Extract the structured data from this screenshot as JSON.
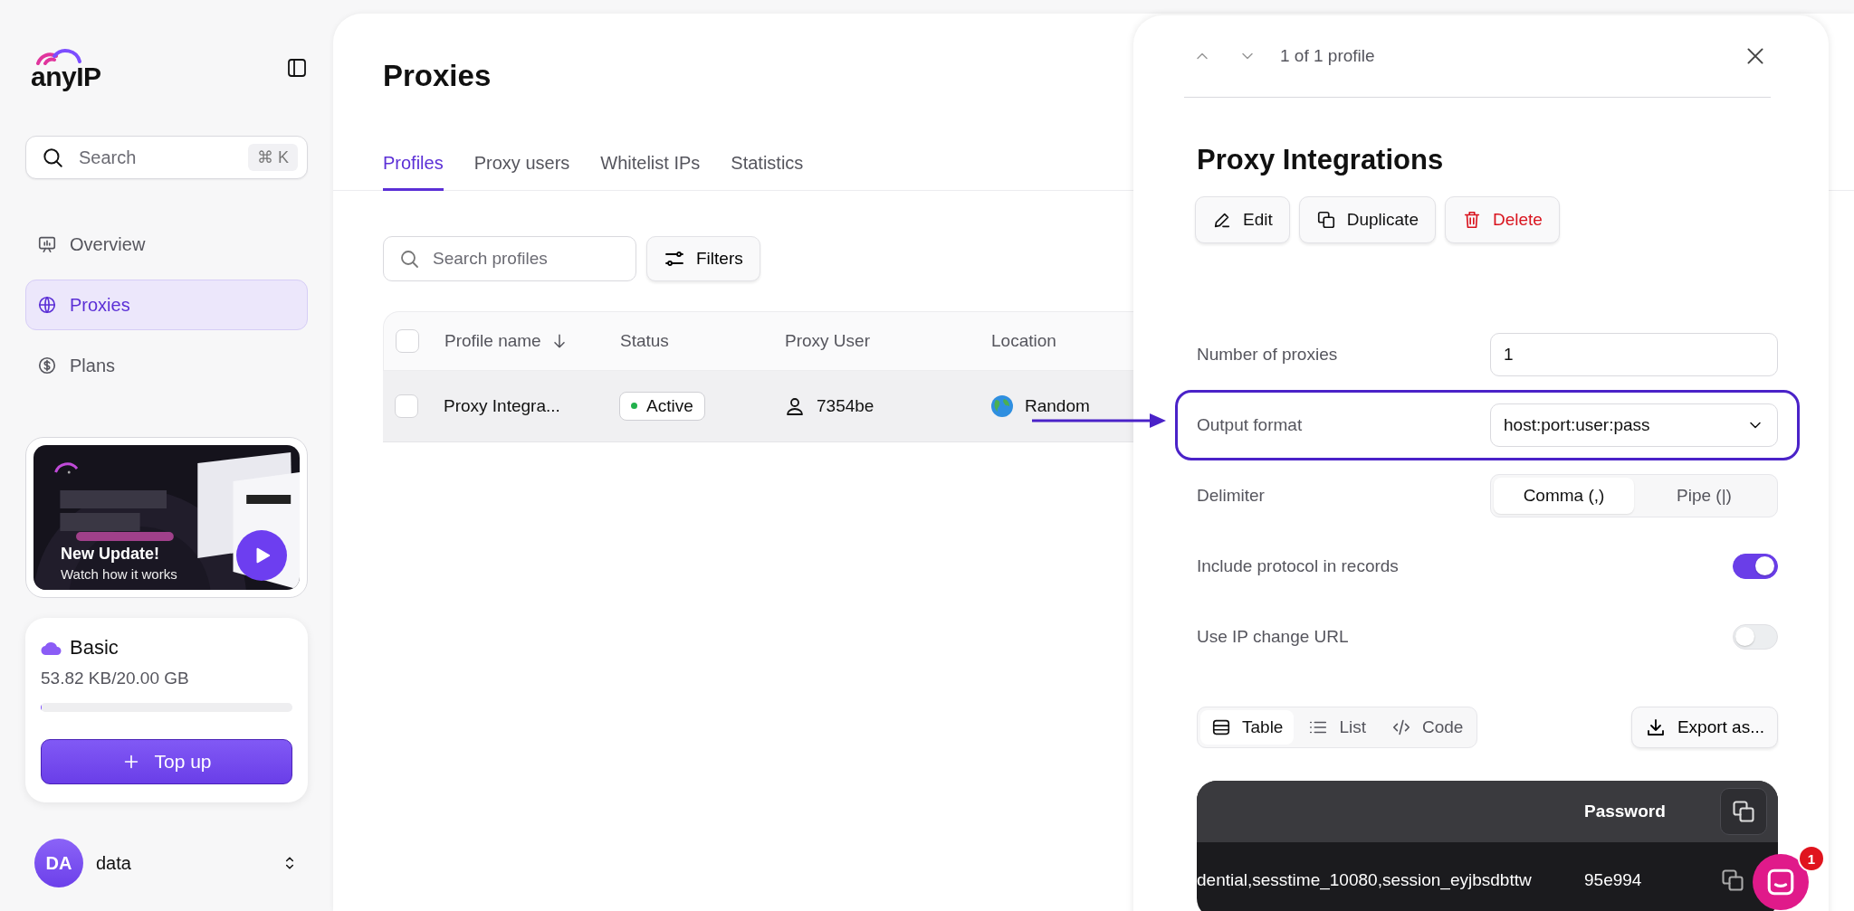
{
  "sidebar": {
    "logo": "anyIP",
    "search": {
      "placeholder": "Search",
      "shortcut": "⌘ K"
    },
    "nav": [
      {
        "label": "Overview",
        "selected": false
      },
      {
        "label": "Proxies",
        "selected": true
      },
      {
        "label": "Plans",
        "selected": false
      }
    ],
    "promo": {
      "title": "New Update!",
      "subtitle": "Watch how it works"
    },
    "plan": {
      "name": "Basic",
      "usage": "53.82 KB/20.00 GB",
      "level": 0.003,
      "button": "Top up"
    },
    "user": {
      "initials": "DA",
      "name": "data"
    }
  },
  "main": {
    "title": "Proxies",
    "tabs": [
      {
        "label": "Profiles",
        "selected": true
      },
      {
        "label": "Proxy users",
        "selected": false
      },
      {
        "label": "Whitelist IPs",
        "selected": false
      },
      {
        "label": "Statistics",
        "selected": false
      }
    ],
    "search": {
      "placeholder": "Search profiles"
    },
    "filters": "Filters",
    "table": {
      "all_checked": false,
      "columns": [
        "Profile name",
        "Status",
        "Proxy User",
        "Location"
      ],
      "rows": [
        {
          "checked": false,
          "selected": true,
          "name": "Proxy Integra...",
          "status": "Active",
          "user": "7354be",
          "location": "Random"
        }
      ]
    }
  },
  "panel": {
    "counter": "1 of 1 profile",
    "title": "Proxy Integrations",
    "actions": [
      {
        "label": "Edit",
        "kind": "edit"
      },
      {
        "label": "Duplicate",
        "kind": "duplicate"
      },
      {
        "label": "Delete",
        "kind": "delete"
      }
    ],
    "fields": [
      {
        "kind": "input",
        "label": "Number of proxies",
        "value": "1"
      },
      {
        "kind": "select",
        "label": "Output format",
        "value": "host:port:user:pass",
        "highlighted": true
      },
      {
        "kind": "segmented",
        "label": "Delimiter",
        "options": [
          {
            "label": "Comma (,)",
            "selected": true
          },
          {
            "label": "Pipe (|)",
            "selected": false
          }
        ]
      },
      {
        "kind": "toggle",
        "label": "Include protocol in records",
        "on": true
      },
      {
        "kind": "toggle",
        "label": "Use IP change URL",
        "on": false
      }
    ],
    "views": [
      {
        "label": "Table",
        "selected": true
      },
      {
        "label": "List",
        "selected": false
      },
      {
        "label": "Code",
        "selected": false
      }
    ],
    "export": "Export as...",
    "results": {
      "columns": [
        "Password"
      ],
      "rows": [
        {
          "proxy": "dential,sesstime_10080,session_eyjbsdbttw",
          "password": "95e994"
        }
      ]
    }
  },
  "chat": {
    "badge": "1"
  }
}
